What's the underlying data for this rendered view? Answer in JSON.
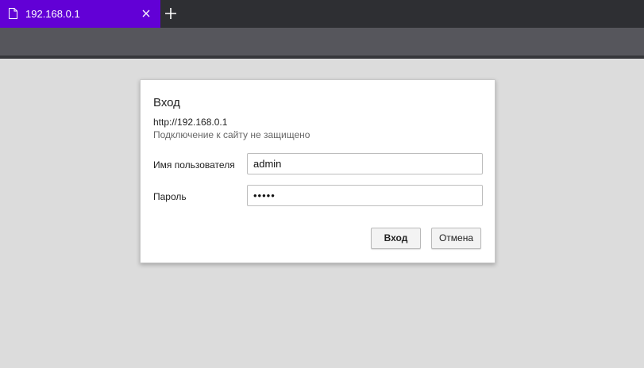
{
  "browser": {
    "tab": {
      "title": "192.168.0.1"
    }
  },
  "dialog": {
    "title": "Вход",
    "url": "http://192.168.0.1",
    "warning": "Подключение к сайту не защищено",
    "username_label": "Имя пользователя",
    "username_value": "admin",
    "password_label": "Пароль",
    "password_value": "•••••",
    "ok_label": "Вход",
    "cancel_label": "Отмена"
  },
  "colors": {
    "tab_accent": "#6200d6",
    "page_background": "#dcdcdc"
  },
  "icons": [
    "file-icon",
    "close-icon",
    "plus-icon"
  ]
}
